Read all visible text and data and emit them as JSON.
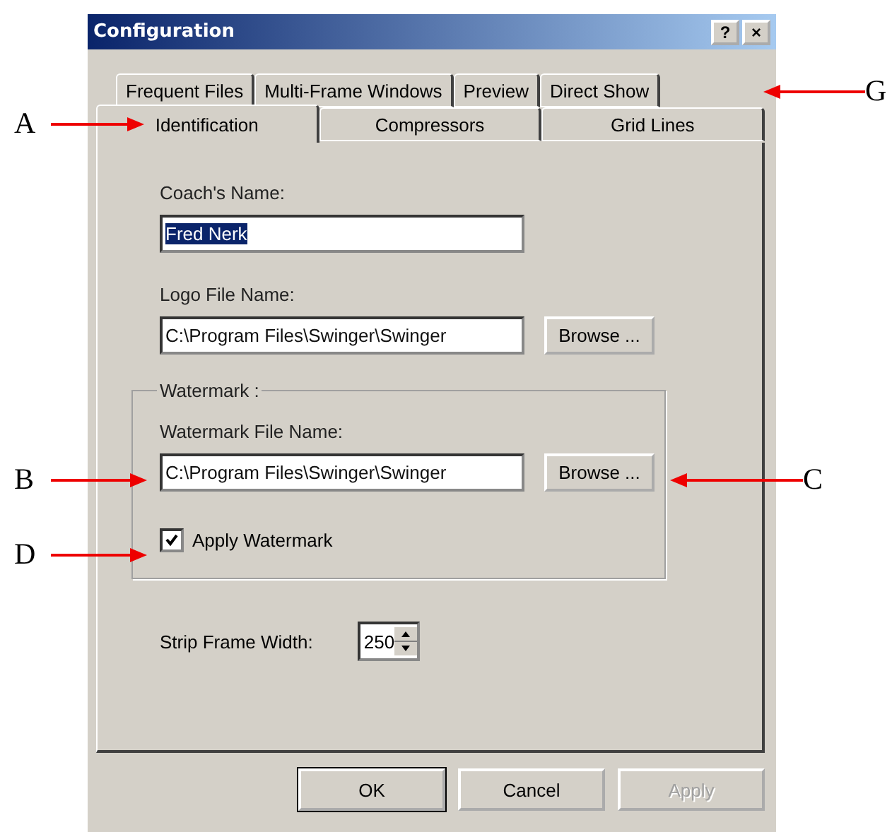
{
  "window": {
    "title": "Configuration",
    "title_buttons": [
      "?",
      "×"
    ]
  },
  "tab_rows": [
    [
      {
        "label": "Frequent Files",
        "selected": false
      },
      {
        "label": "Multi-Frame Windows",
        "selected": false
      },
      {
        "label": "Preview",
        "selected": false
      },
      {
        "label": "Direct Show",
        "selected": false
      }
    ],
    [
      {
        "label": "Identification",
        "selected": true
      },
      {
        "label": "Compressors",
        "selected": false
      },
      {
        "label": "Grid Lines",
        "selected": false
      }
    ]
  ],
  "coach_name": {
    "label": "Coach's Name:",
    "value": "Fred Nerk"
  },
  "logo_file": {
    "label": "Logo File Name:",
    "value": "C:\\Program Files\\Swinger\\Swinger",
    "button": "Browse ..."
  },
  "watermark": {
    "title": "Watermark :",
    "label": "Watermark File Name:",
    "value": "C:\\Program Files\\Swinger\\Swinger",
    "button": "Browse ...",
    "apply": {
      "label": "Apply Watermark",
      "checked": true
    }
  },
  "strip_frame_width": {
    "label": "Strip Frame Width:",
    "value": "250"
  },
  "buttons": [
    {
      "label": "OK",
      "disabled": false
    },
    {
      "label": "Cancel",
      "disabled": false
    },
    {
      "label": "Apply",
      "disabled": true
    }
  ],
  "annotations": [
    {
      "letter": "A"
    },
    {
      "letter": "B"
    },
    {
      "letter": "C"
    },
    {
      "letter": "D"
    },
    {
      "letter": "G"
    }
  ]
}
